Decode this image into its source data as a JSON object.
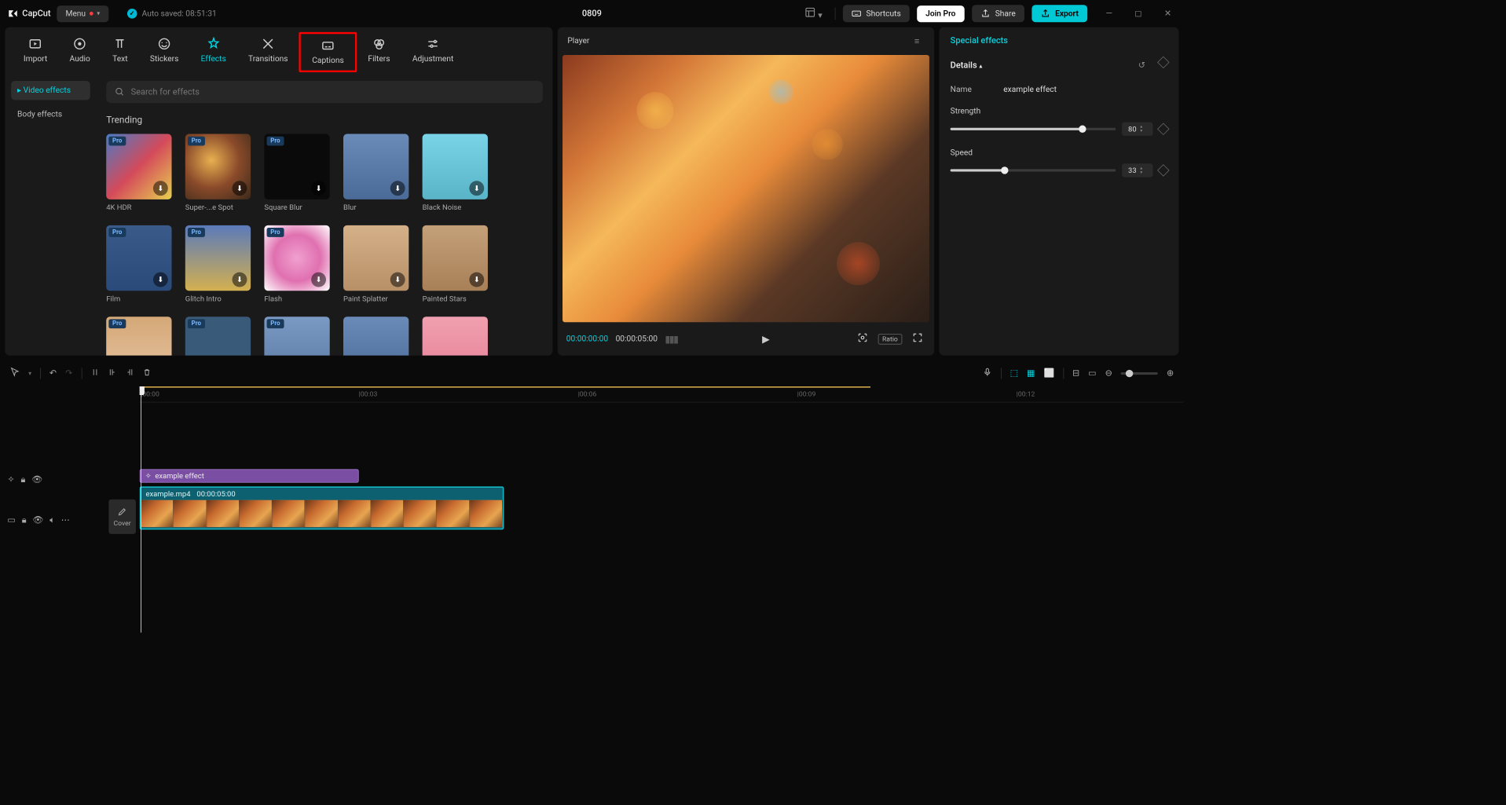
{
  "titlebar": {
    "app_name": "CapCut",
    "menu_label": "Menu",
    "autosave": "Auto saved: 08:51:31",
    "project": "0809",
    "shortcuts": "Shortcuts",
    "join_pro": "Join Pro",
    "share": "Share",
    "export": "Export"
  },
  "tabs": {
    "import": "Import",
    "audio": "Audio",
    "text": "Text",
    "stickers": "Stickers",
    "effects": "Effects",
    "transitions": "Transitions",
    "captions": "Captions",
    "filters": "Filters",
    "adjustment": "Adjustment"
  },
  "sidebar": {
    "video_effects": "Video effects",
    "body_effects": "Body effects"
  },
  "search": {
    "placeholder": "Search for effects"
  },
  "trending": {
    "title": "Trending",
    "items": [
      {
        "label": "4K HDR",
        "pro": true,
        "dl": true
      },
      {
        "label": "Super-...e Spot",
        "pro": true,
        "dl": true
      },
      {
        "label": "Square Blur",
        "pro": true,
        "dl": true
      },
      {
        "label": "Blur",
        "pro": false,
        "dl": true
      },
      {
        "label": "Black Noise",
        "pro": false,
        "dl": true
      },
      {
        "label": "Film",
        "pro": true,
        "dl": true
      },
      {
        "label": "Glitch Intro",
        "pro": true,
        "dl": true
      },
      {
        "label": "Flash",
        "pro": true,
        "dl": true
      },
      {
        "label": "Paint Splatter",
        "pro": false,
        "dl": true
      },
      {
        "label": "Painted Stars",
        "pro": false,
        "dl": true
      },
      {
        "label": "",
        "pro": true,
        "dl": false
      },
      {
        "label": "",
        "pro": true,
        "dl": false
      },
      {
        "label": "",
        "pro": true,
        "dl": false
      },
      {
        "label": "",
        "pro": false,
        "dl": false
      },
      {
        "label": "",
        "pro": false,
        "dl": false
      }
    ]
  },
  "player": {
    "title": "Player",
    "tc_current": "00:00:00:00",
    "tc_total": "00:00:05:00",
    "ratio": "Ratio"
  },
  "panel": {
    "title": "Special effects",
    "details": "Details",
    "name_label": "Name",
    "name_value": "example effect",
    "strength_label": "Strength",
    "strength_value": "80",
    "speed_label": "Speed",
    "speed_value": "33"
  },
  "timeline": {
    "ticks": [
      "|00:00",
      "|00:03",
      "|00:06",
      "|00:09",
      "|00:12"
    ],
    "fx_clip": "example effect",
    "video_name": "example.mp4",
    "video_dur": "00:00:05:00",
    "cover": "Cover"
  },
  "thumb_colors": [
    "linear-gradient(135deg,#4a7bc4,#d44a5a,#e8d050)",
    "radial-gradient(circle at 40% 40%,#e8b050,#8a4a2a,#3a2a1a)",
    "#0a0a0a",
    "linear-gradient(#6a8ab8,#4a6a98)",
    "linear-gradient(#7ad4e8,#5ab4c8)",
    "linear-gradient(#3a5a8a,#2a4a7a)",
    "linear-gradient(#5a7aba,#d4b050)",
    "radial-gradient(circle,#f0a0d0,#e070b0,#fff)",
    "linear-gradient(#d4b088,#b89068)",
    "linear-gradient(#c4a078,#a88058)",
    "linear-gradient(#d4a878,#e8c4a0)",
    "#3a5a7a",
    "linear-gradient(#7a9ac4,#5a7aa4)",
    "linear-gradient(#6a8ab8,#4a6a98)",
    "linear-gradient(#f0a0b0,#e88098)"
  ]
}
